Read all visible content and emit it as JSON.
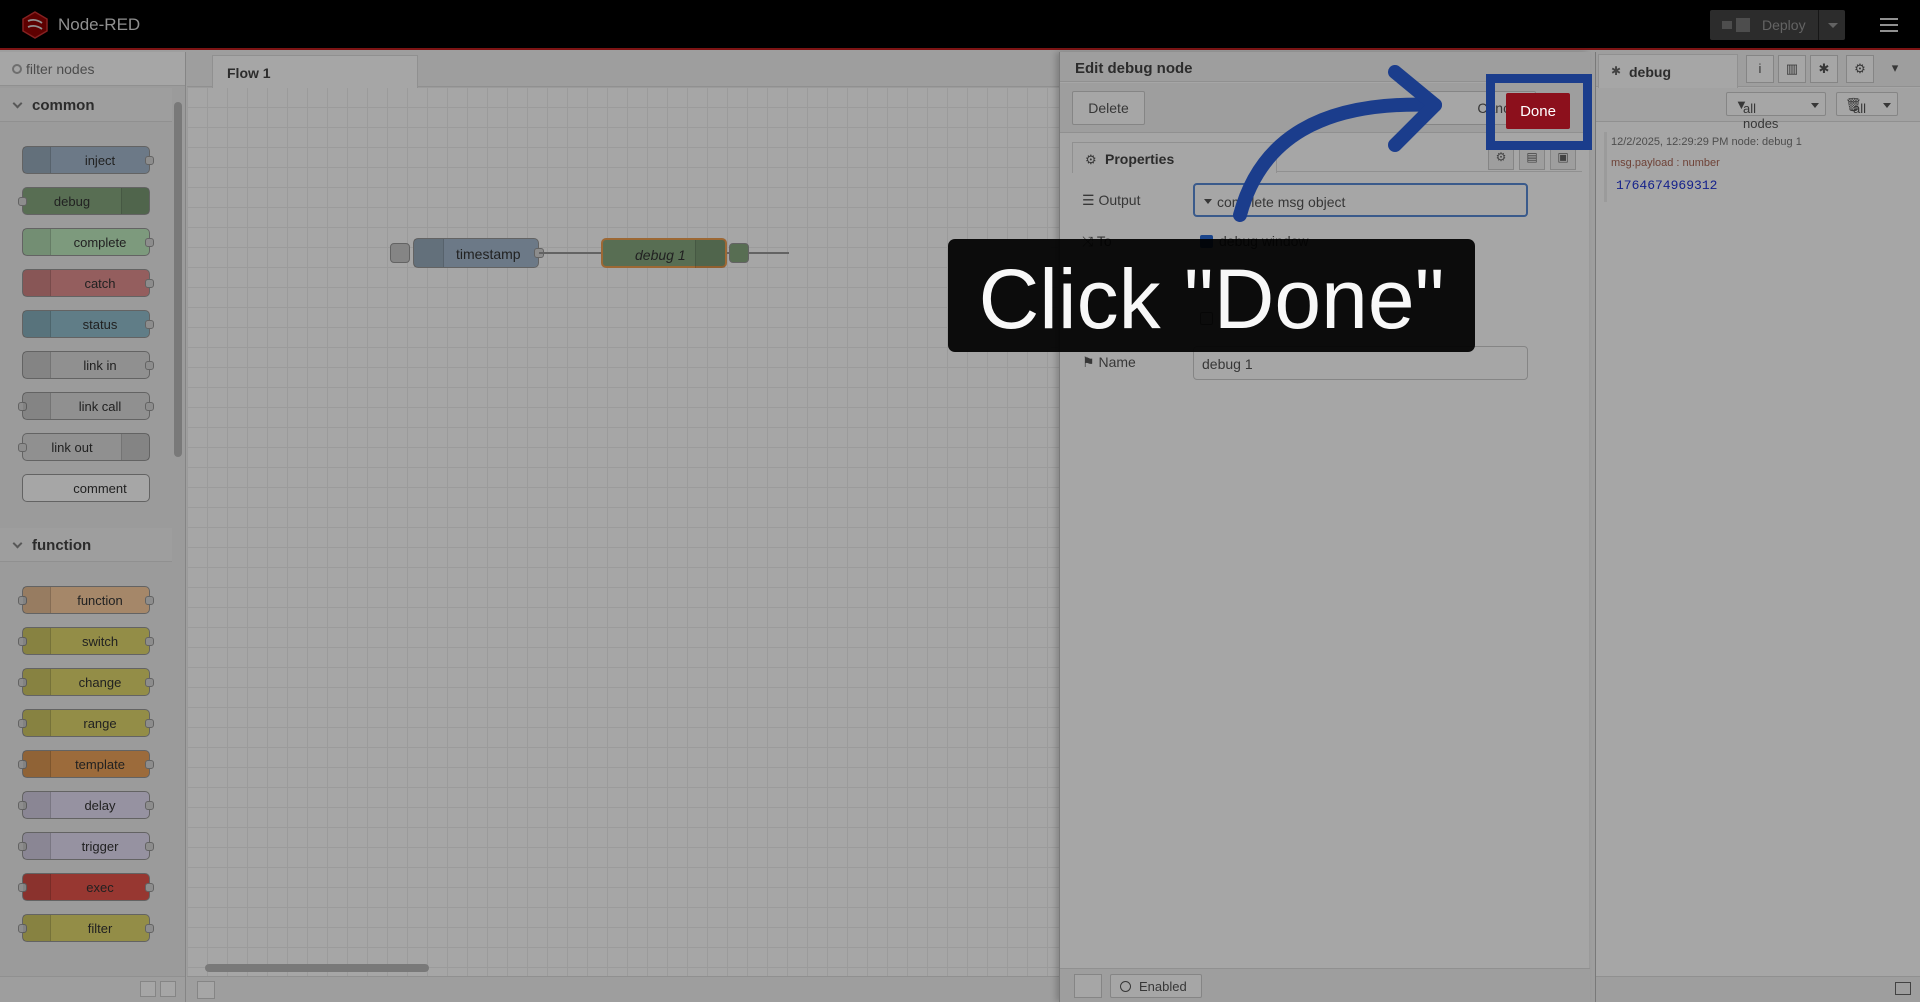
{
  "header": {
    "app_title": "Node-RED",
    "deploy_label": "Deploy"
  },
  "palette": {
    "filter_placeholder": "filter nodes",
    "categories": [
      {
        "label": "common",
        "nodes": [
          "inject",
          "debug",
          "complete",
          "catch",
          "status",
          "link in",
          "link call",
          "link out",
          "comment"
        ]
      },
      {
        "label": "function",
        "nodes": [
          "function",
          "switch",
          "change",
          "range",
          "template",
          "delay",
          "trigger",
          "exec",
          "filter"
        ]
      }
    ]
  },
  "workspace": {
    "tab_label": "Flow 1",
    "nodes": {
      "timestamp": "timestamp",
      "debug": "debug 1"
    }
  },
  "tray": {
    "title": "Edit debug node",
    "delete_label": "Delete",
    "cancel_label": "Cancel",
    "done_label": "Done",
    "properties_tab": "Properties",
    "output_label": "Output",
    "output_value": "complete msg object",
    "to_label": "To",
    "to_option": "debug window",
    "name_label": "Name",
    "name_value": "debug 1",
    "enabled_label": "Enabled"
  },
  "sidebar": {
    "tab_label": "debug",
    "filter_nodes": "all nodes",
    "clear_label": "all",
    "message": {
      "meta": "12/2/2025, 12:29:29 PM   node: debug 1",
      "property": "msg.payload : number",
      "value": "1764674969312"
    }
  },
  "annotation": {
    "text": "Click \"Done\"",
    "color": "#1b3d8c"
  },
  "colors": {
    "done_button": "#8c101c",
    "header_border": "#c02020"
  }
}
